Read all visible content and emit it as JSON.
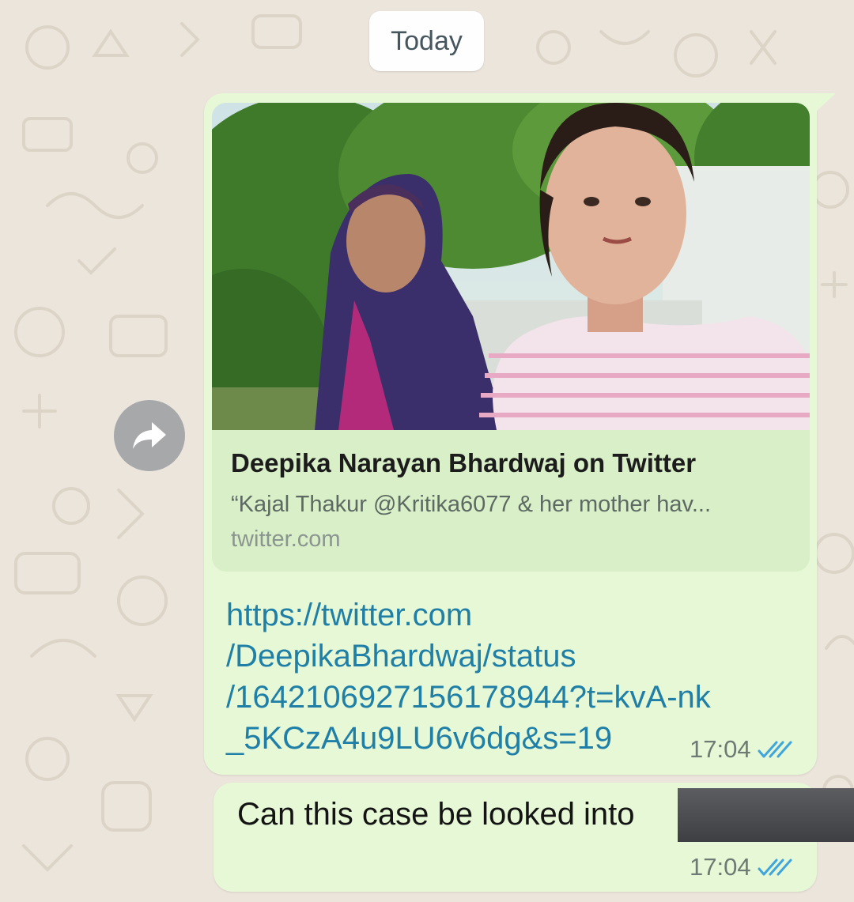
{
  "chat": {
    "date_chip": "Today",
    "link_message": {
      "preview": {
        "title": "Deepika Narayan Bhardwaj on Twitter",
        "description": "“Kajal Thakur @Kritika6077 & her mother hav...",
        "domain": "twitter.com"
      },
      "url_lines": [
        "https://twitter.com",
        "/DeepikaBhardwaj/status",
        "/1642106927156178944?t=kvA-nk",
        "_5KCzA4u9LU6v6dg&s=19"
      ],
      "time": "17:04",
      "status": "read"
    },
    "text_message": {
      "text": "Can this case be looked into",
      "time": "17:04",
      "status": "read"
    },
    "forward_icon": "forward-arrow-icon"
  },
  "colors": {
    "wallpaper": "#ece5dc",
    "outgoing_bubble": "#e6f8d6",
    "link": "#1f7fa7",
    "read_ticks": "#3fa5dc"
  }
}
